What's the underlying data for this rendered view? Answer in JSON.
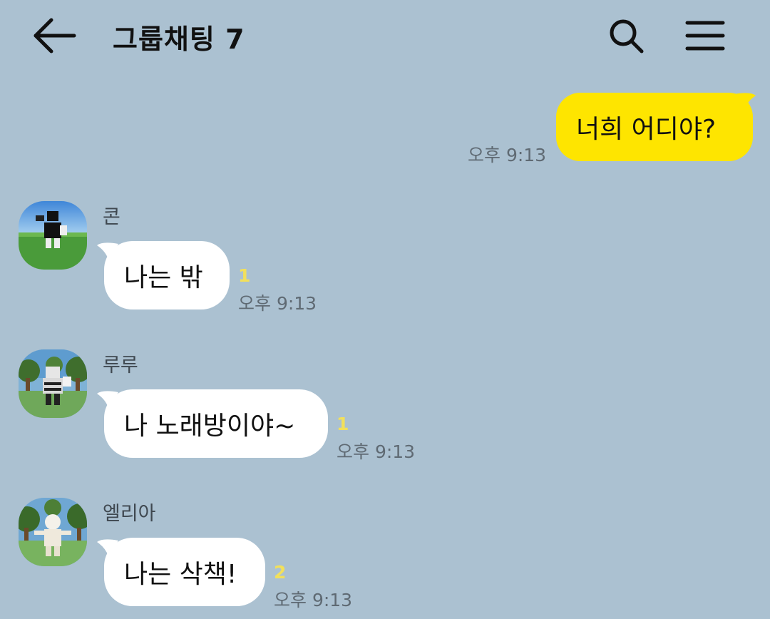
{
  "header": {
    "title": "그룹채팅 7",
    "back_icon": "arrow-left-icon",
    "search_icon": "search-icon",
    "menu_icon": "hamburger-menu-icon"
  },
  "colors": {
    "background": "#abc1d1",
    "my_bubble": "#fee500",
    "other_bubble": "#ffffff",
    "unread_count": "#f2e05b"
  },
  "messages": [
    {
      "sender": "",
      "text": "너희 어디야?",
      "time": "오후 9:13",
      "unread": "",
      "mine": true
    },
    {
      "sender": "콘",
      "text": "나는 밖",
      "time": "오후 9:13",
      "unread": "1",
      "mine": false
    },
    {
      "sender": "루루",
      "text": "나 노래방이야~",
      "time": "오후 9:13",
      "unread": "1",
      "mine": false
    },
    {
      "sender": "엘리아",
      "text": "나는 삭책!",
      "time": "오후 9:13",
      "unread": "2",
      "mine": false
    }
  ]
}
